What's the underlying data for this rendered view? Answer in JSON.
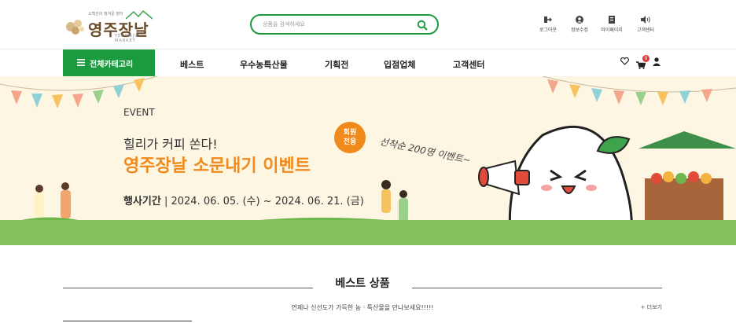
{
  "header": {
    "logo_tagline": "소백산의 정겨운 장터",
    "logo_text": "영주장날",
    "logo_sub": "YEONGJU MARKET",
    "search_placeholder": "상품을 검색하세요",
    "utils": [
      {
        "label": "로그아웃",
        "icon": "logout-icon"
      },
      {
        "label": "정보수정",
        "icon": "user-icon"
      },
      {
        "label": "마이페이지",
        "icon": "mypage-icon"
      },
      {
        "label": "고객센터",
        "icon": "speaker-icon"
      }
    ]
  },
  "nav": {
    "all_categories": "전체카테고리",
    "items": [
      "베스트",
      "우수농특산물",
      "기획전",
      "입점업체",
      "고객센터"
    ],
    "cart_count": "0"
  },
  "banner": {
    "event_label": "EVENT",
    "line1": "힐리가 커피 쏜다!",
    "line2": "영주장날 소문내기 이벤트",
    "period_label": "행사기간",
    "period_value": " | 2024. 06. 05. (수) ~ 2024. 06. 21. (금)",
    "member_badge": "회원\n전용",
    "script_text": "선착순 200명 이벤트~",
    "colors": {
      "accent": "#f08a1c",
      "green": "#1c9a3f",
      "ground": "#84c25b",
      "bg": "#fdf6e3"
    }
  },
  "section": {
    "title": "베스트 상품",
    "subtitle": "언제나 신선도가 가득한 농 · 특산물을 만나보세요!!!!!",
    "more": "+ 더보기"
  }
}
